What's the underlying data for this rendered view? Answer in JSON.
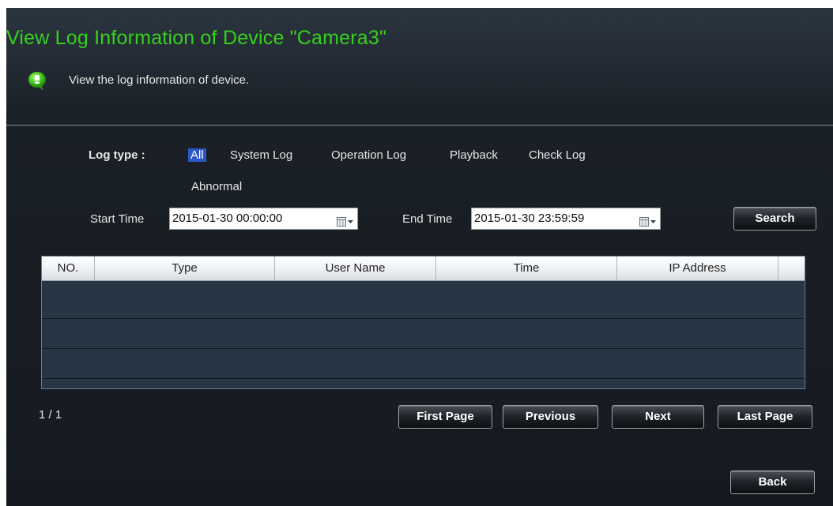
{
  "header": {
    "title": "View Log Information of Device \"Camera3\"",
    "subtitle": "View the log information of device.",
    "info_icon": "info-bubble-icon"
  },
  "filters": {
    "log_type_label": "Log type :",
    "log_types": [
      "All",
      "System Log",
      "Operation Log",
      "Playback",
      "Check Log",
      "Abnormal"
    ],
    "selected_log_type": "All",
    "start_time_label": "Start Time",
    "start_time_value": "2015-01-30  00:00:00",
    "end_time_label": "End Time",
    "end_time_value": "2015-01-30  23:59:59",
    "calendar_icon": "calendar-dropdown-icon",
    "search_label": "Search"
  },
  "table": {
    "columns": [
      "NO.",
      "Type",
      "User Name",
      "Time",
      "IP Address"
    ],
    "rows": []
  },
  "pagination": {
    "page_info": "1 / 1",
    "first_label": "First Page",
    "previous_label": "Previous",
    "next_label": "Next",
    "last_label": "Last Page"
  },
  "footer": {
    "back_label": "Back"
  },
  "colors": {
    "title_green": "#36d11a",
    "panel_bg": "#161a20",
    "table_bg": "#263645",
    "selected_bg": "#2a57c8"
  }
}
